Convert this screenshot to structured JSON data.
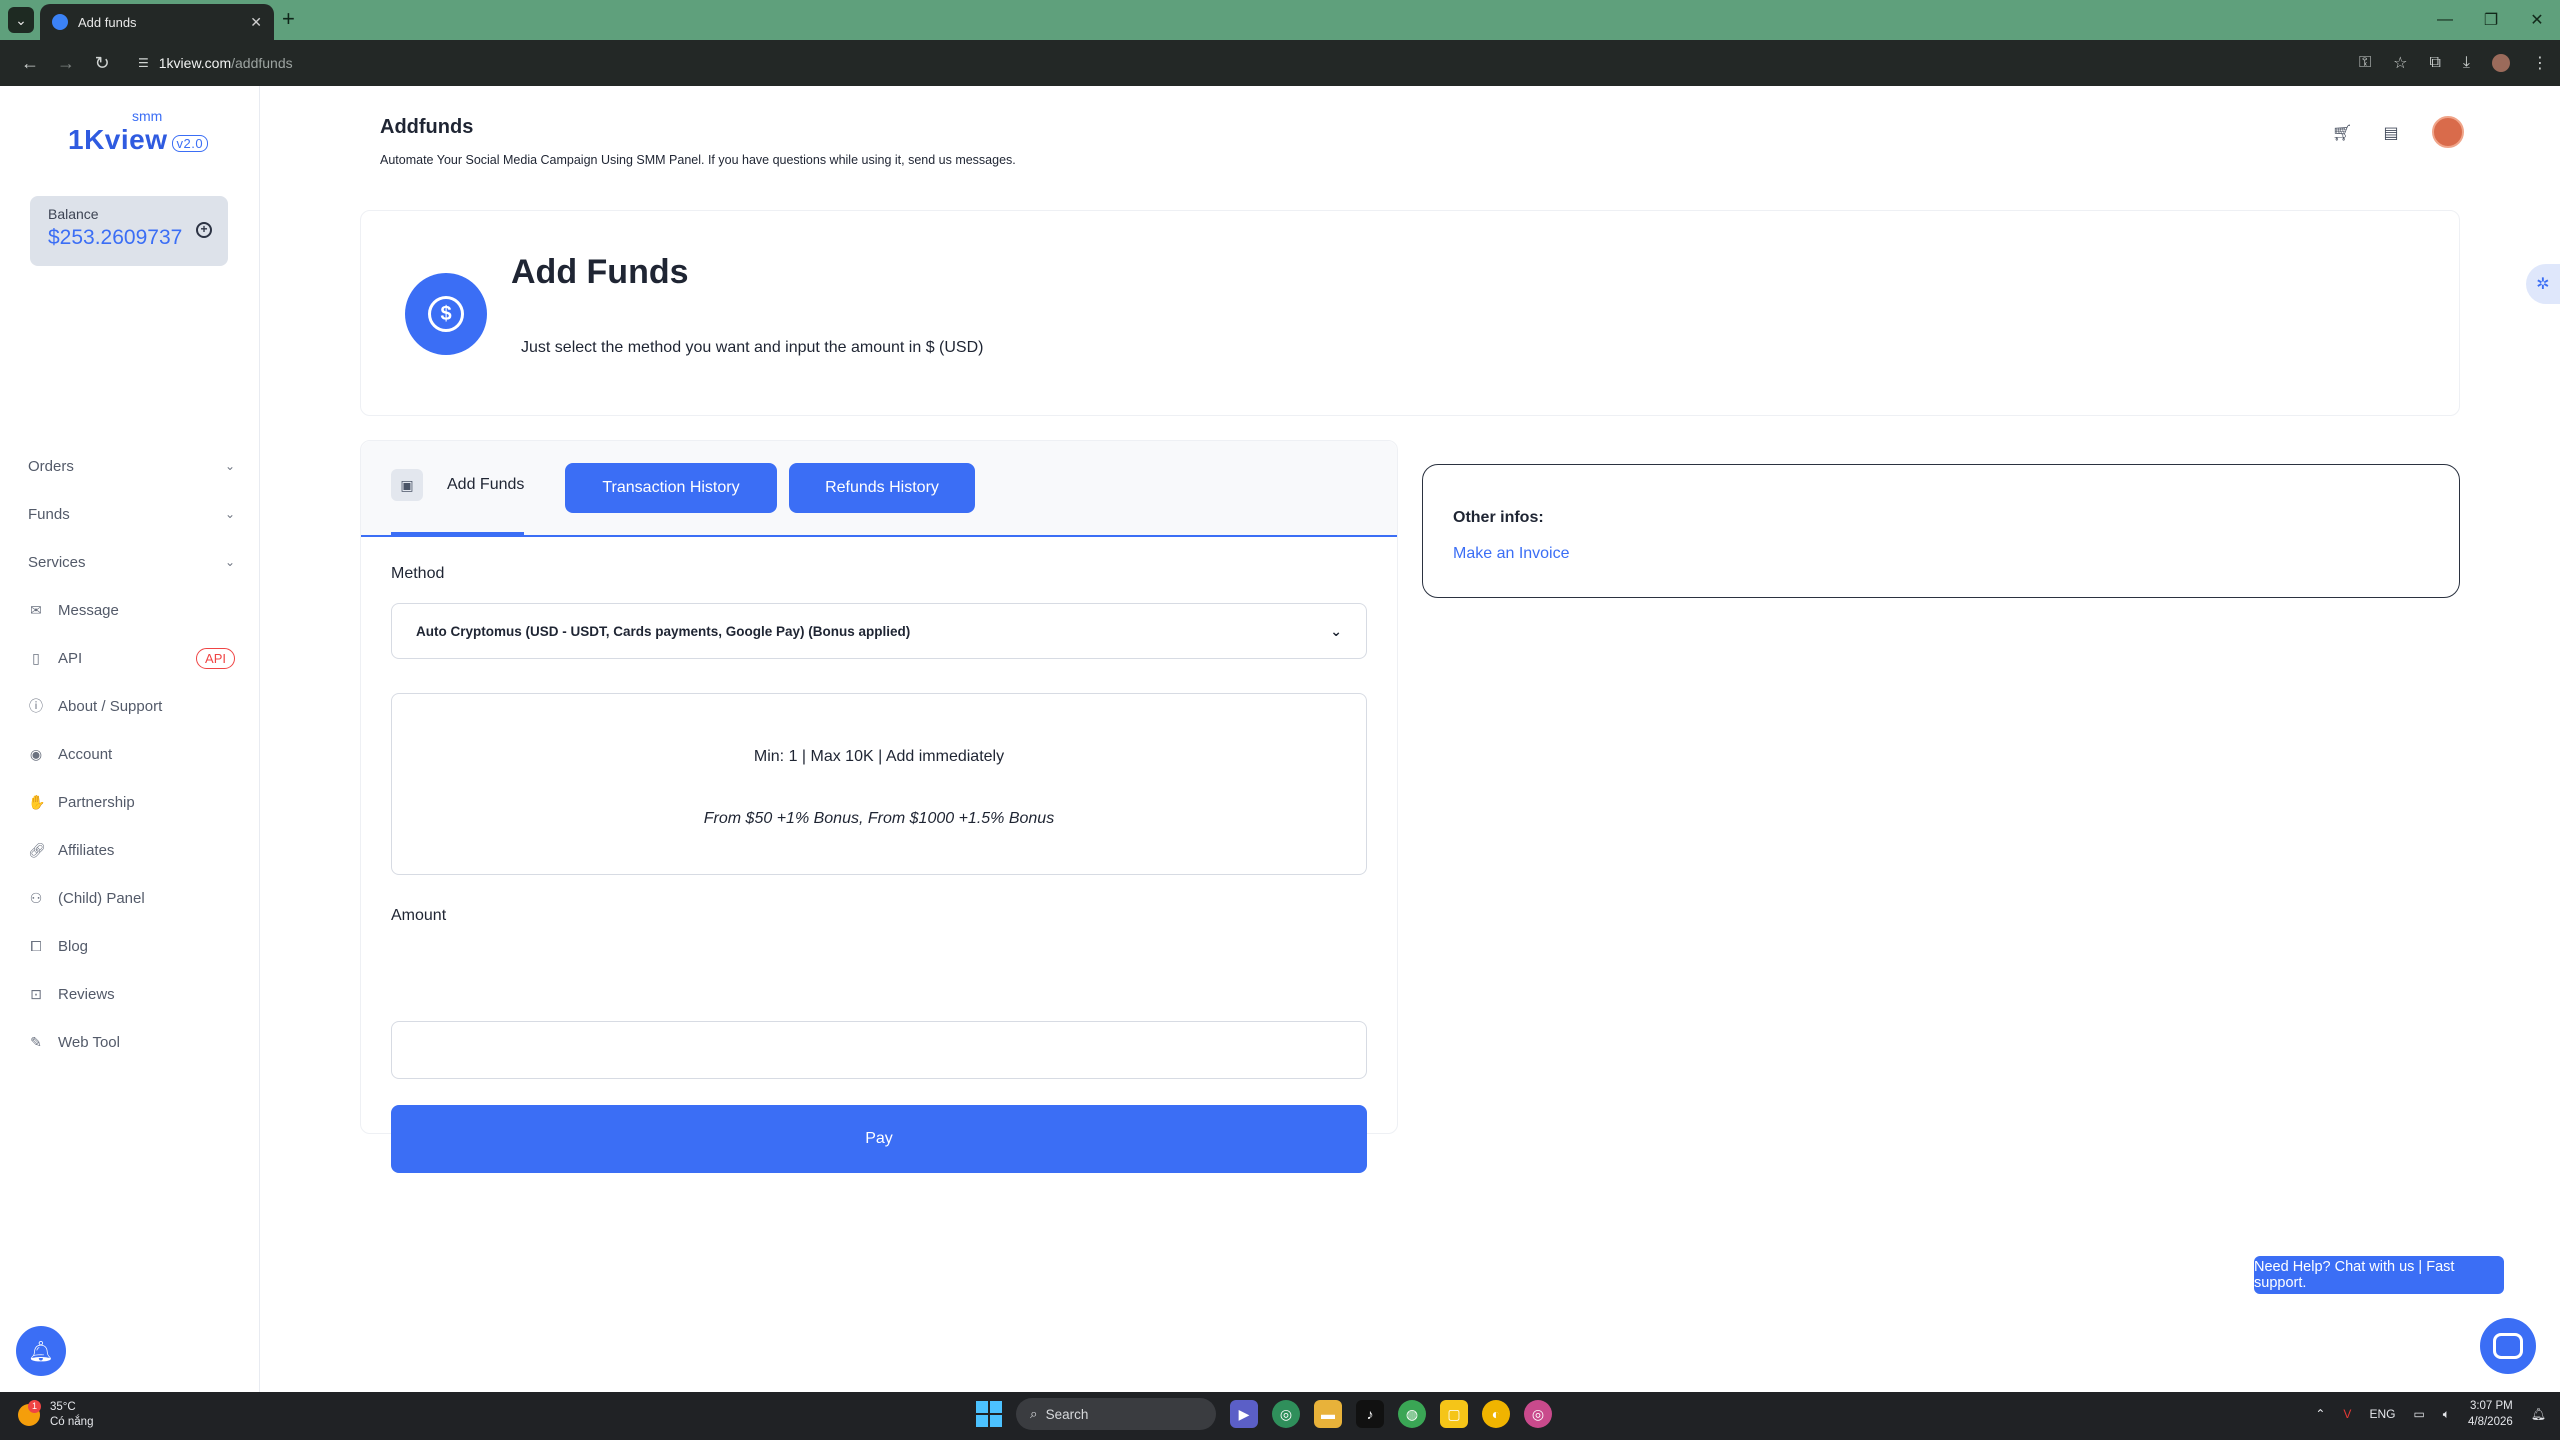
{
  "browser": {
    "tab_title": "Add funds",
    "url_host": "1kview.com",
    "url_path": "/addfunds"
  },
  "sidebar": {
    "logo_smm": "smm",
    "logo_name": "1Kview",
    "logo_version": "v2.0",
    "balance_label": "Balance",
    "balance_value": "$253.2609737",
    "items": [
      {
        "label": "Orders",
        "icon": "chevron-down-icon",
        "expandable": true
      },
      {
        "label": "Funds",
        "icon": "chevron-down-icon",
        "expandable": true
      },
      {
        "label": "Services",
        "icon": "chevron-down-icon",
        "expandable": true
      },
      {
        "label": "Message",
        "icon": "message-icon"
      },
      {
        "label": "API",
        "icon": "document-icon",
        "badge": "API"
      },
      {
        "label": "About / Support",
        "icon": "info-icon"
      },
      {
        "label": "Account",
        "icon": "user-icon"
      },
      {
        "label": "Partnership",
        "icon": "partnership-icon"
      },
      {
        "label": "Affiliates",
        "icon": "link-icon"
      },
      {
        "label": "(Child) Panel",
        "icon": "users-icon"
      },
      {
        "label": "Blog",
        "icon": "book-icon"
      },
      {
        "label": "Reviews",
        "icon": "bookmark-icon"
      },
      {
        "label": "Web Tool",
        "icon": "edit-icon"
      }
    ]
  },
  "header": {
    "title": "Addfunds",
    "subtitle": "Automate Your Social Media Campaign Using SMM Panel. If you have questions while using it, send us messages."
  },
  "banner": {
    "title": "Add Funds",
    "subtitle": "Just select the method you want and input the amount in $ (USD)"
  },
  "form": {
    "tabs": [
      {
        "label": "Add Funds",
        "active": true
      },
      {
        "label": "Transaction History"
      },
      {
        "label": "Refunds History"
      }
    ],
    "method_label": "Method",
    "method_value": "Auto Cryptomus (USD - USDT, Cards payments, Google Pay) (Bonus applied)",
    "info_limits": "Min: 1 | Max 10K | Add immediately",
    "info_bonus": "From $50 +1% Bonus, From $1000 +1.5% Bonus",
    "amount_label": "Amount",
    "amount_value": "",
    "pay_label": "Pay"
  },
  "other": {
    "title": "Other infos:",
    "link": "Make an Invoice"
  },
  "support": {
    "chip": "Need Help? Chat with us | Fast support."
  },
  "taskbar": {
    "weather_badge": "1",
    "temperature": "35°C",
    "condition": "Có nắng",
    "search_placeholder": "Search",
    "lang": "ENG",
    "time": "3:07 PM",
    "date": "4/8/2026"
  },
  "colors": {
    "accent": "#3b6ef5",
    "tab_bar": "#5fa07c",
    "api_badge": "#ef4444"
  }
}
